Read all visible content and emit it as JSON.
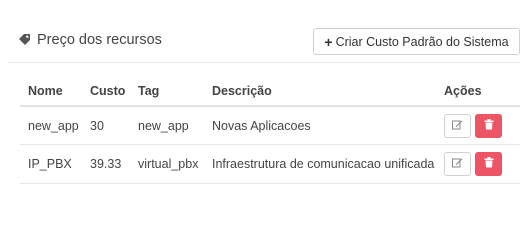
{
  "header": {
    "title": "Preço dos recursos",
    "title_icon": "tag-icon",
    "create_button_label": "Criar Custo Padrão do Sistema",
    "create_button_icon": "plus-icon"
  },
  "table": {
    "columns": [
      "Nome",
      "Custo",
      "Tag",
      "Descrição",
      "Ações"
    ],
    "rows": [
      {
        "name": "new_app",
        "cost": "30",
        "tag": "new_app",
        "description": "Novas Aplicacoes"
      },
      {
        "name": "IP_PBX",
        "cost": "39.33",
        "tag": "virtual_pbx",
        "description": "Infraestrutura de comunicacao unificada"
      }
    ]
  },
  "colors": {
    "delete_button": "#ed5565",
    "text": "#444444",
    "border": "#e6e6e6"
  },
  "icons": {
    "edit": "edit-icon",
    "delete": "trash-icon"
  }
}
